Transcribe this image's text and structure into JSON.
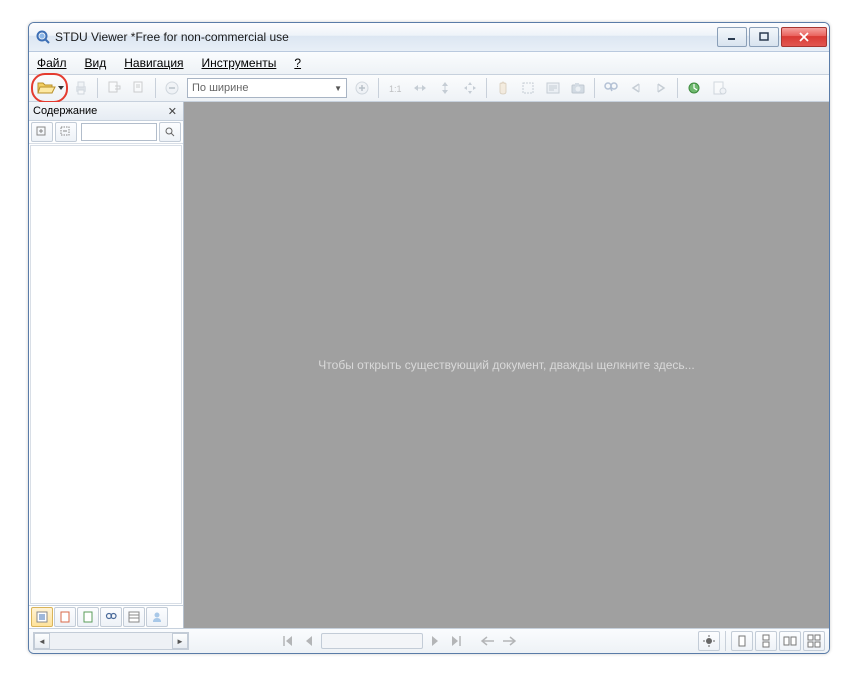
{
  "window": {
    "title": "STDU Viewer *Free for non-commercial use"
  },
  "menu": {
    "file": "Файл",
    "view": "Вид",
    "nav": "Навигация",
    "tools": "Инструменты",
    "help": "?"
  },
  "toolbar": {
    "zoom_mode": "По ширине"
  },
  "sidebar": {
    "title": "Содержание"
  },
  "empty_msg": "Чтобы открыть существующий документ, дважды щелкните здесь..."
}
